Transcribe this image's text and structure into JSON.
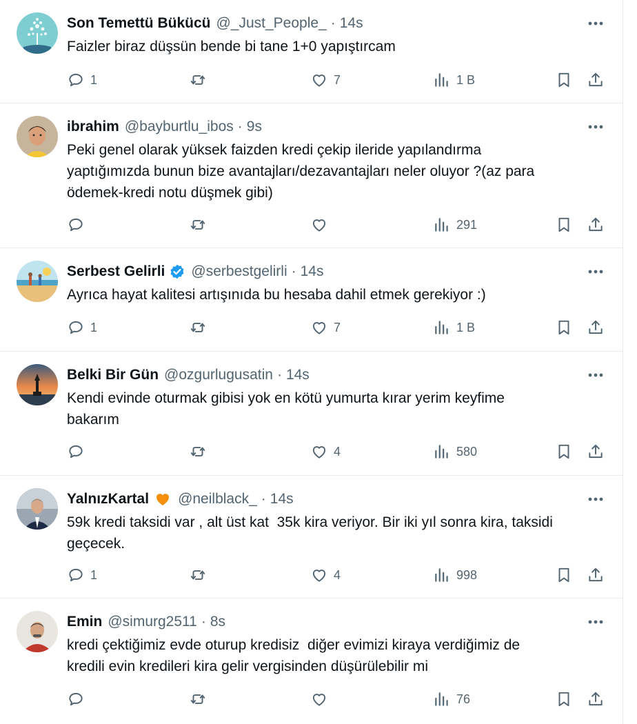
{
  "tweets": [
    {
      "name": "Son Temettü Bükücü",
      "handle": "@_Just_People_",
      "sep": "·",
      "time": "14s",
      "text": "Faizler biraz düşsün bende bi tane 1+0 yapıştırcam",
      "replies": "1",
      "retweets": "",
      "likes": "7",
      "views": "1 B",
      "verified": false,
      "emoji": false
    },
    {
      "name": "ibrahim",
      "handle": "@bayburtlu_ibos",
      "sep": "·",
      "time": "9s",
      "text": "Peki genel olarak yüksek faizden kredi çekip ileride yapılandırma\nyaptığımızda bunun bize avantajları/dezavantajları neler oluyor ?(az para\nödemek-kredi notu düşmek gibi)",
      "replies": "",
      "retweets": "",
      "likes": "",
      "views": "291",
      "verified": false,
      "emoji": false
    },
    {
      "name": "Serbest Gelirli",
      "handle": "@serbestgelirli",
      "sep": "·",
      "time": "14s",
      "text": "Ayrıca hayat kalitesi artışınıda bu hesaba dahil etmek gerekiyor :)",
      "replies": "1",
      "retweets": "",
      "likes": "7",
      "views": "1 B",
      "verified": true,
      "emoji": false
    },
    {
      "name": "Belki Bir Gün",
      "handle": "@ozgurlugusatin",
      "sep": "·",
      "time": "14s",
      "text": "Kendi evinde oturmak gibisi yok en kötü yumurta kırar yerim keyfime\nbakarım",
      "replies": "",
      "retweets": "",
      "likes": "4",
      "views": "580",
      "verified": false,
      "emoji": false
    },
    {
      "name": "YalnızKartal",
      "handle": "@neilblack_",
      "sep": "·",
      "time": "14s",
      "text": "59k kredi taksidi var , alt üst kat  35k kira veriyor. Bir iki yıl sonra kira, taksidi\ngeçecek.",
      "replies": "1",
      "retweets": "",
      "likes": "4",
      "views": "998",
      "verified": false,
      "emoji": true
    },
    {
      "name": "Emin",
      "handle": "@simurg2511",
      "sep": "·",
      "time": "8s",
      "text": "kredi çektiğimiz evde oturup kredisiz  diğer evimizi kiraya verdiğimiz de\nkredili evin kredileri kira gelir vergisinden düşürülebilir mi",
      "replies": "",
      "retweets": "",
      "likes": "",
      "views": "76",
      "verified": false,
      "emoji": false
    }
  ],
  "icons": {
    "reply": "reply-icon",
    "retweet": "retweet-icon",
    "like": "heart-icon",
    "views": "analytics-icon",
    "bookmark": "bookmark-icon",
    "share": "share-icon",
    "more": "more-icon",
    "verified": "verified-badge-icon",
    "emoji": "orange-heart-icon"
  },
  "colors": {
    "text": "#0f1419",
    "secondary": "#536471",
    "verified": "#1d9bf0",
    "emoji": "#f4900c",
    "divider": "#e6ecf0"
  }
}
